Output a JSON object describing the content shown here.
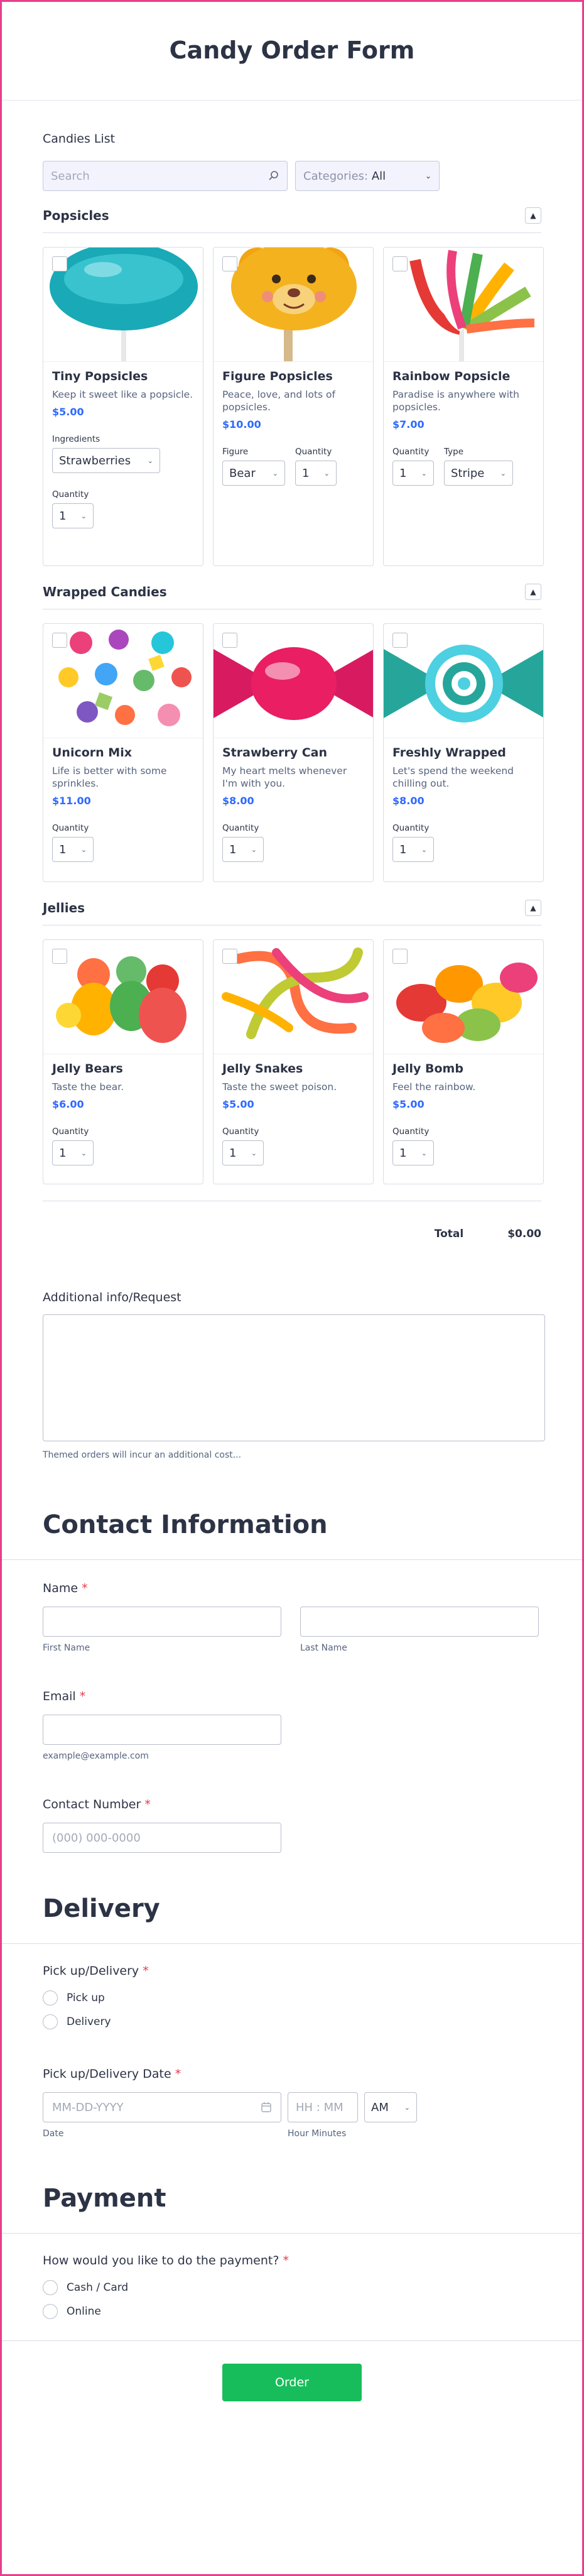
{
  "form": {
    "title": "Candy Order Form"
  },
  "list": {
    "label": "Candies List",
    "search_placeholder": "Search",
    "categories_label": "Categories:",
    "categories_value": "All"
  },
  "popsicles": {
    "title": "Popsicles",
    "products": [
      {
        "name": "Tiny Popsicles",
        "desc": "Keep it sweet like a popsicle.",
        "price": "$5.00",
        "opt1_label": "Ingredients",
        "opt1_value": "Strawberries",
        "qty_label": "Quantity",
        "qty": "1"
      },
      {
        "name": "Figure Popsicles",
        "desc": "Peace, love, and lots of popsicles.",
        "price": "$10.00",
        "opt1_label": "Figure",
        "opt1_value": "Bear",
        "qty_label": "Quantity",
        "qty": "1"
      },
      {
        "name": "Rainbow Popsicle",
        "desc": "Paradise is anywhere with popsicles.",
        "price": "$7.00",
        "qty_label": "Quantity",
        "qty": "1",
        "opt2_label": "Type",
        "opt2_value": "Stripe"
      }
    ]
  },
  "wrapped": {
    "title": "Wrapped Candies",
    "products": [
      {
        "name": "Unicorn Mix",
        "desc": "Life is better with some sprinkles.",
        "price": "$11.00",
        "qty_label": "Quantity",
        "qty": "1"
      },
      {
        "name": "Strawberry Can",
        "desc": "My heart melts whenever I'm with you.",
        "price": "$8.00",
        "qty_label": "Quantity",
        "qty": "1"
      },
      {
        "name": "Freshly Wrapped",
        "desc": "Let's spend the weekend chilling out.",
        "price": "$8.00",
        "qty_label": "Quantity",
        "qty": "1"
      }
    ]
  },
  "jellies": {
    "title": "Jellies",
    "products": [
      {
        "name": "Jelly Bears",
        "desc": "Taste the bear.",
        "price": "$6.00",
        "qty_label": "Quantity",
        "qty": "1"
      },
      {
        "name": "Jelly Snakes",
        "desc": "Taste the sweet poison.",
        "price": "$5.00",
        "qty_label": "Quantity",
        "qty": "1"
      },
      {
        "name": "Jelly Bomb",
        "desc": "Feel the rainbow.",
        "price": "$5.00",
        "qty_label": "Quantity",
        "qty": "1"
      }
    ]
  },
  "total": {
    "label": "Total",
    "value": "$0.00"
  },
  "additional": {
    "label": "Additional info/Request",
    "note": "Themed orders will incur an additional cost..."
  },
  "contact": {
    "title": "Contact Information",
    "name_label": "Name",
    "first_name_sub": "First Name",
    "last_name_sub": "Last Name",
    "email_label": "Email",
    "email_sub": "example@example.com",
    "phone_label": "Contact Number",
    "phone_placeholder": "(000) 000-0000"
  },
  "delivery": {
    "title": "Delivery",
    "method_label": "Pick up/Delivery",
    "options": [
      "Pick up",
      "Delivery"
    ],
    "date_label": "Pick up/Delivery Date",
    "date_placeholder": "MM-DD-YYYY",
    "date_sub": "Date",
    "time_placeholder": "HH : MM",
    "time_sub": "Hour Minutes",
    "ampm": "AM"
  },
  "payment": {
    "title": "Payment",
    "question": "How would you like to do the payment?",
    "options": [
      "Cash / Card",
      "Online"
    ]
  },
  "submit": {
    "label": "Order"
  },
  "required_mark": "*",
  "colors": {
    "accent": "#2e69ff",
    "border": "#e83e8c",
    "submit": "#18bd5b",
    "required": "#e6394b"
  }
}
